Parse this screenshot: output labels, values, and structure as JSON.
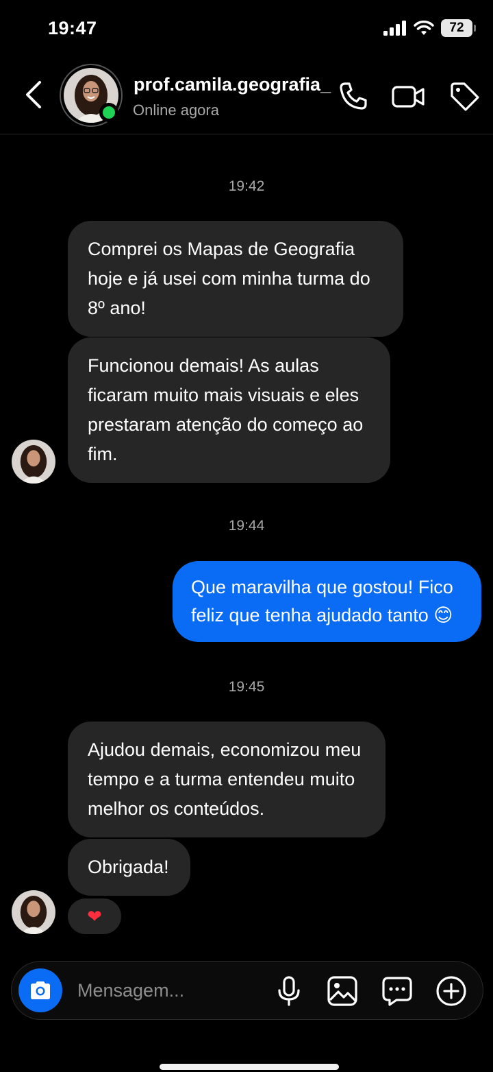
{
  "status_bar": {
    "time": "19:47",
    "battery": "72",
    "icons": [
      "signal-icon",
      "wifi-icon",
      "battery-icon"
    ]
  },
  "header": {
    "username": "prof.camila.geografia_",
    "presence": "Online agora",
    "icons": [
      "back-icon",
      "phone-icon",
      "video-icon",
      "tag-icon"
    ]
  },
  "chat": {
    "timestamps": [
      "19:42",
      "19:44",
      "19:45"
    ],
    "messages": [
      {
        "from": "them",
        "text": "Comprei os Mapas de Geografia hoje e já usei com minha turma do 8º ano!"
      },
      {
        "from": "them",
        "text": "Funcionou demais! As aulas ficaram muito mais visuais e eles prestaram atenção do começo ao fim."
      },
      {
        "from": "me",
        "text": "Que maravilha que gostou! Fico feliz que tenha ajudado tanto 😊"
      },
      {
        "from": "them",
        "text": "Ajudou demais, economizou meu tempo e a turma entendeu muito melhor os conteúdos."
      },
      {
        "from": "them",
        "text": "Obrigada!"
      }
    ],
    "reaction": "❤"
  },
  "composer": {
    "placeholder": "Mensagem...",
    "icons": [
      "camera-icon",
      "microphone-icon",
      "gallery-icon",
      "sticker-icon",
      "plus-icon"
    ]
  },
  "colors": {
    "accent_blue": "#0a6cf5",
    "bubble_gray": "#262626",
    "online_green": "#1fd155",
    "background": "#000000"
  }
}
